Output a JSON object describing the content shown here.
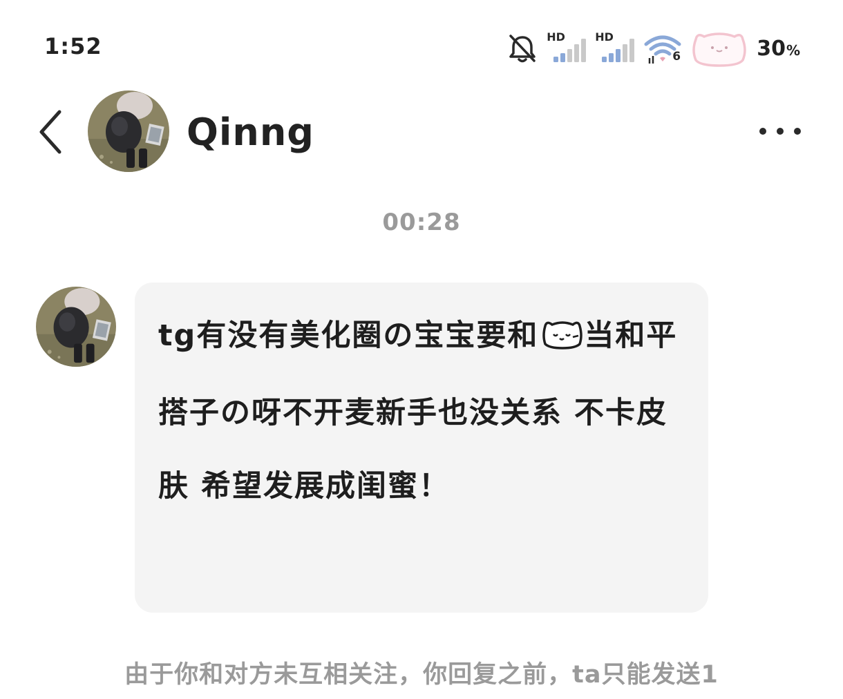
{
  "status_bar": {
    "time": "1:52",
    "signal_1_label": "HD",
    "signal_2_label": "HD",
    "wifi_label": "6",
    "battery_percent": "30",
    "battery_unit": "%",
    "icons": [
      "bell-muted-icon",
      "signal-hd-icon",
      "signal-hd-icon",
      "wifi-6-icon",
      "cat-face-sticker-icon"
    ]
  },
  "header": {
    "back_icon": "chevron-left-icon",
    "contact_name": "Qinng",
    "more_icon": "ellipsis-icon"
  },
  "conversation": {
    "timestamp": "00:28",
    "messages": [
      {
        "sender": "Qinng",
        "text_before_emoji": "tg有没有美化圈の宝宝要和",
        "emoji": "cat-face-emoji-icon",
        "text_after_emoji": "当和平搭子の呀不开麦新手也没关系  不卡皮肤  希望发展成闺蜜！"
      }
    ],
    "notice": "由于你和对方未互相关注，你回复之前，ta只能发送1"
  },
  "colors": {
    "background": "#ffffff",
    "bubble": "#f4f4f4",
    "text": "#222222",
    "muted_text": "#9a9a9a",
    "wifi_blue": "#8aa8d8",
    "sticker_pink": "#f3c4cf"
  }
}
